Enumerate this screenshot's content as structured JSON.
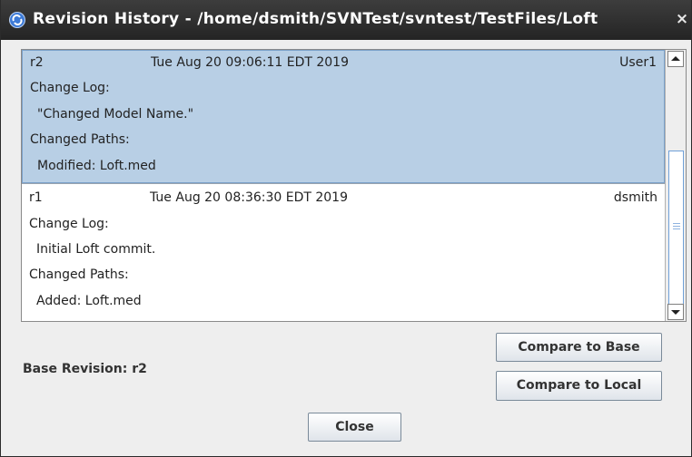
{
  "window": {
    "title": "Revision History - /home/dsmith/SVNTest/svntest/TestFiles/Loft",
    "close_glyph": "×"
  },
  "revisions": [
    {
      "rev": "r2",
      "date": "Tue Aug 20 09:06:11 EDT 2019",
      "author": "User1",
      "change_log_label": "Change Log:",
      "message": "\"Changed Model Name.\"",
      "changed_paths_label": "Changed Paths:",
      "path": "Modified: Loft.med",
      "selected": true
    },
    {
      "rev": "r1",
      "date": "Tue Aug 20 08:36:30 EDT 2019",
      "author": "dsmith",
      "change_log_label": "Change Log:",
      "message": "Initial Loft commit.",
      "changed_paths_label": "Changed Paths:",
      "path": "Added: Loft.med",
      "selected": false
    }
  ],
  "base_revision_label": "Base Revision: r2",
  "buttons": {
    "compare_base": "Compare to Base",
    "compare_local": "Compare to Local",
    "close": "Close"
  },
  "colors": {
    "selection": "#b8cfe5",
    "titlebar": "#2f2f2f",
    "accent": "#3d7ad6"
  },
  "icons": {
    "app": "app-logo-icon",
    "close": "close-icon",
    "scroll_up": "scroll-up-arrow-icon",
    "scroll_down": "scroll-down-arrow-icon"
  }
}
